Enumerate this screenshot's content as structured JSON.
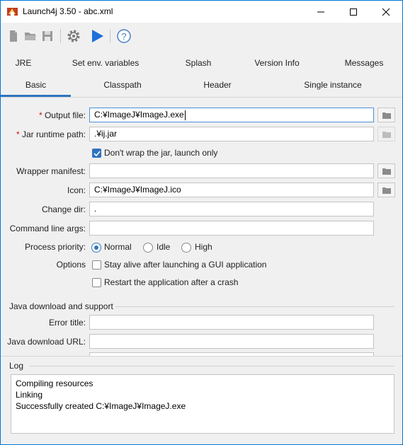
{
  "window": {
    "title": "Launch4j 3.50 - abc.xml"
  },
  "tabs_row1": [
    "JRE",
    "Set env. variables",
    "Splash",
    "Version Info",
    "Messages"
  ],
  "tabs_row2": [
    "Basic",
    "Classpath",
    "Header",
    "Single instance"
  ],
  "selected_tab": "Basic",
  "basic": {
    "output_file_label": "Output file:",
    "output_file_value": "C:¥ImageJ¥ImageJ.exe",
    "jar_label": "Jar runtime path:",
    "jar_value": ".¥ij.jar",
    "dont_wrap_label": "Don't wrap the jar, launch only",
    "dont_wrap_checked": true,
    "wrapper_manifest_label": "Wrapper manifest:",
    "wrapper_manifest_value": "",
    "icon_label": "Icon:",
    "icon_value": "C:¥ImageJ¥ImageJ.ico",
    "change_dir_label": "Change dir:",
    "change_dir_value": ".",
    "cmd_args_label": "Command line args:",
    "cmd_args_value": "",
    "priority_label": "Process priority:",
    "priority_options": [
      "Normal",
      "Idle",
      "High"
    ],
    "priority_selected": "Normal",
    "options_label": "Options",
    "stay_alive_label": "Stay alive after launching a GUI application",
    "restart_label": "Restart the application after a crash"
  },
  "java_download": {
    "section_title": "Java download and support",
    "error_title_label": "Error title:",
    "error_title_value": "",
    "download_url_label": "Java download URL:",
    "download_url_value": ""
  },
  "log": {
    "title": "Log",
    "lines": [
      "Compiling resources",
      "Linking",
      "Successfully created C:¥ImageJ¥ImageJ.exe"
    ]
  },
  "colors": {
    "accent": "#2f74c0",
    "required": "#d01010",
    "play": "#1e6fd9"
  },
  "icons": [
    "app-icon",
    "new-icon",
    "open-icon",
    "save-icon",
    "settings-icon",
    "build-icon",
    "help-icon",
    "folder-icon"
  ]
}
